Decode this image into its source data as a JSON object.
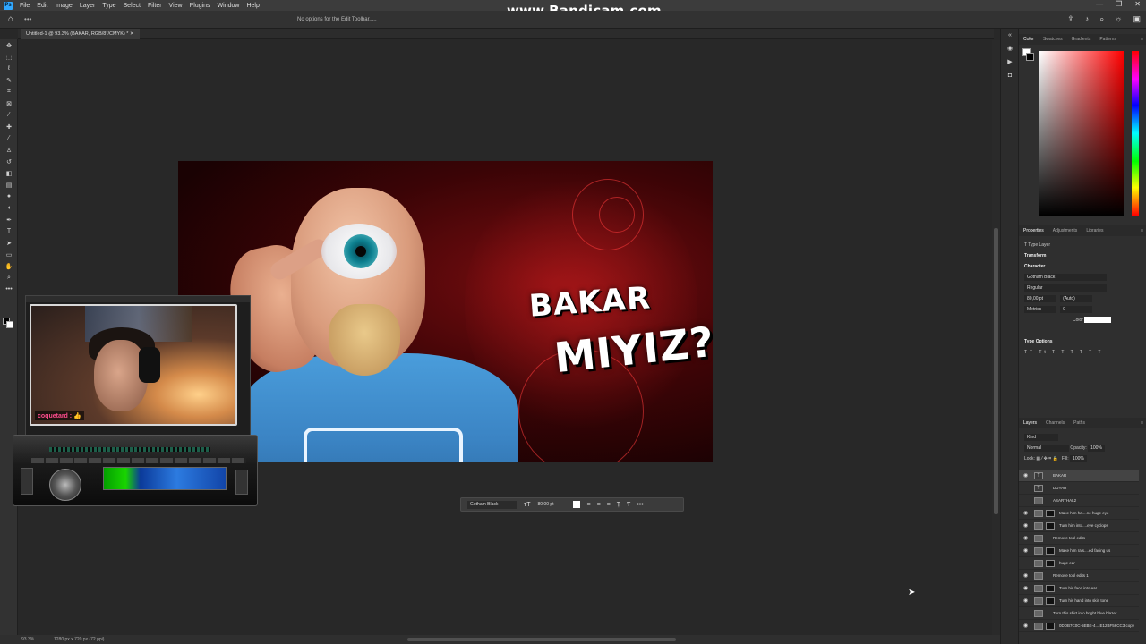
{
  "watermark": "www.Bandicam.com",
  "menubar": {
    "logo": "Ps",
    "items": [
      "File",
      "Edit",
      "Image",
      "Layer",
      "Type",
      "Select",
      "Filter",
      "View",
      "Plugins",
      "Window",
      "Help"
    ],
    "window_controls": [
      "—",
      "❐",
      "✕"
    ]
  },
  "options_bar": {
    "message": "No options for the Edit Toolbar.....",
    "icons": [
      "share-icon",
      "bell-icon",
      "search-icon",
      "lightbulb-icon",
      "cube-icon"
    ]
  },
  "document": {
    "tab_title": "Untitled-1 @ 93.3% (BAKAR, RGB/8*/CMYK) *",
    "zoom": "93.3%",
    "size": "1280 px x 720 px (72 ppi)"
  },
  "artwork": {
    "title_line1": "BAKAR",
    "title_line2": "MIYIZ?"
  },
  "webcam": {
    "chat_user": "coquetard :",
    "chat_msg": "👍"
  },
  "context_bar": {
    "font": "Gotham Black",
    "size": "80,00 pt"
  },
  "panels": {
    "color_tabs": [
      "Color",
      "Swatches",
      "Gradients",
      "Patterns"
    ],
    "property_tabs": [
      "Properties",
      "Adjustments",
      "Libraries"
    ],
    "type_layer_label": "Type Layer",
    "transform_label": "Transform",
    "character_label": "Character",
    "font_family": "Gotham Black",
    "font_style": "Regular",
    "font_size": "80,00 pt",
    "leading": "(Auto)",
    "kerning": "Metrics",
    "tracking": "0",
    "color_label": "Color",
    "type_options_label": "Type Options",
    "layers_tabs": [
      "Layers",
      "Channels",
      "Paths"
    ],
    "kind_filter": "Kind",
    "blend_mode": "Normal",
    "opacity_label": "Opacity:",
    "opacity_value": "100%",
    "lock_label": "Lock:",
    "fill_label": "Fill:",
    "fill_value": "100%"
  },
  "layers": [
    {
      "name": "BAKAR",
      "type": "text",
      "visible": true,
      "selected": true
    },
    {
      "name": "DUYAR",
      "type": "text",
      "visible": false,
      "selected": false
    },
    {
      "name": "ASARTHAL2",
      "type": "image",
      "visible": false,
      "selected": false
    },
    {
      "name": "Make him ha....ne huge eye",
      "type": "masked",
      "visible": true,
      "selected": false
    },
    {
      "name": "Turn him into....eye cyclops",
      "type": "masked",
      "visible": true,
      "selected": false
    },
    {
      "name": "Remove tool edits",
      "type": "image",
      "visible": true,
      "selected": false
    },
    {
      "name": "Make him rais....ed facing us",
      "type": "masked",
      "visible": true,
      "selected": false
    },
    {
      "name": "huge ear",
      "type": "masked",
      "visible": false,
      "selected": false
    },
    {
      "name": "Remove tool edits 1",
      "type": "image",
      "visible": true,
      "selected": false
    },
    {
      "name": "Turn his face into ear",
      "type": "masked",
      "visible": true,
      "selected": false
    },
    {
      "name": "Turn his hand into skin tone",
      "type": "masked",
      "visible": true,
      "selected": false
    },
    {
      "name": "Turn this shirt into bright blue blazer",
      "type": "image",
      "visible": false,
      "selected": false
    },
    {
      "name": "0DDB7C0C-5EBE-4....E12BF56CC3 copy",
      "type": "masked",
      "visible": true,
      "selected": false
    }
  ]
}
